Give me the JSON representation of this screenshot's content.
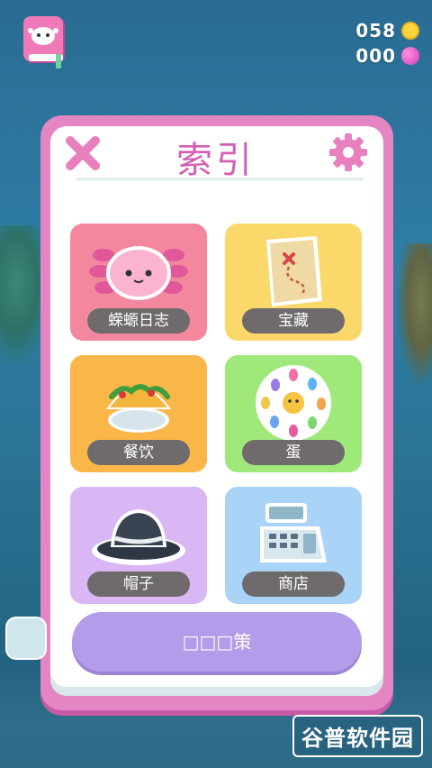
{
  "hud": {
    "coins": "058",
    "gems": "000"
  },
  "index_panel": {
    "title": "索引",
    "tiles": [
      {
        "label": "蝾螈日志",
        "icon": "axolotl-icon"
      },
      {
        "label": "宝藏",
        "icon": "treasure-map-icon"
      },
      {
        "label": "餐饮",
        "icon": "taco-icon"
      },
      {
        "label": "蛋",
        "icon": "egg-icon"
      },
      {
        "label": "帽子",
        "icon": "fedora-hat-icon"
      },
      {
        "label": "商店",
        "icon": "cash-register-icon"
      }
    ],
    "strategy_button": "□□□策"
  },
  "watermark": "谷普软件园",
  "colors": {
    "panel_border": "#e586c4",
    "title": "#d45fb2",
    "tile_pink": "#f3879e",
    "tile_yellow": "#fbd86a",
    "tile_orange": "#fbb64a",
    "tile_green": "#9ee97a",
    "tile_purple": "#d9b7f5",
    "tile_blue": "#a9d3f7",
    "strategy_button": "#b39ce9"
  }
}
